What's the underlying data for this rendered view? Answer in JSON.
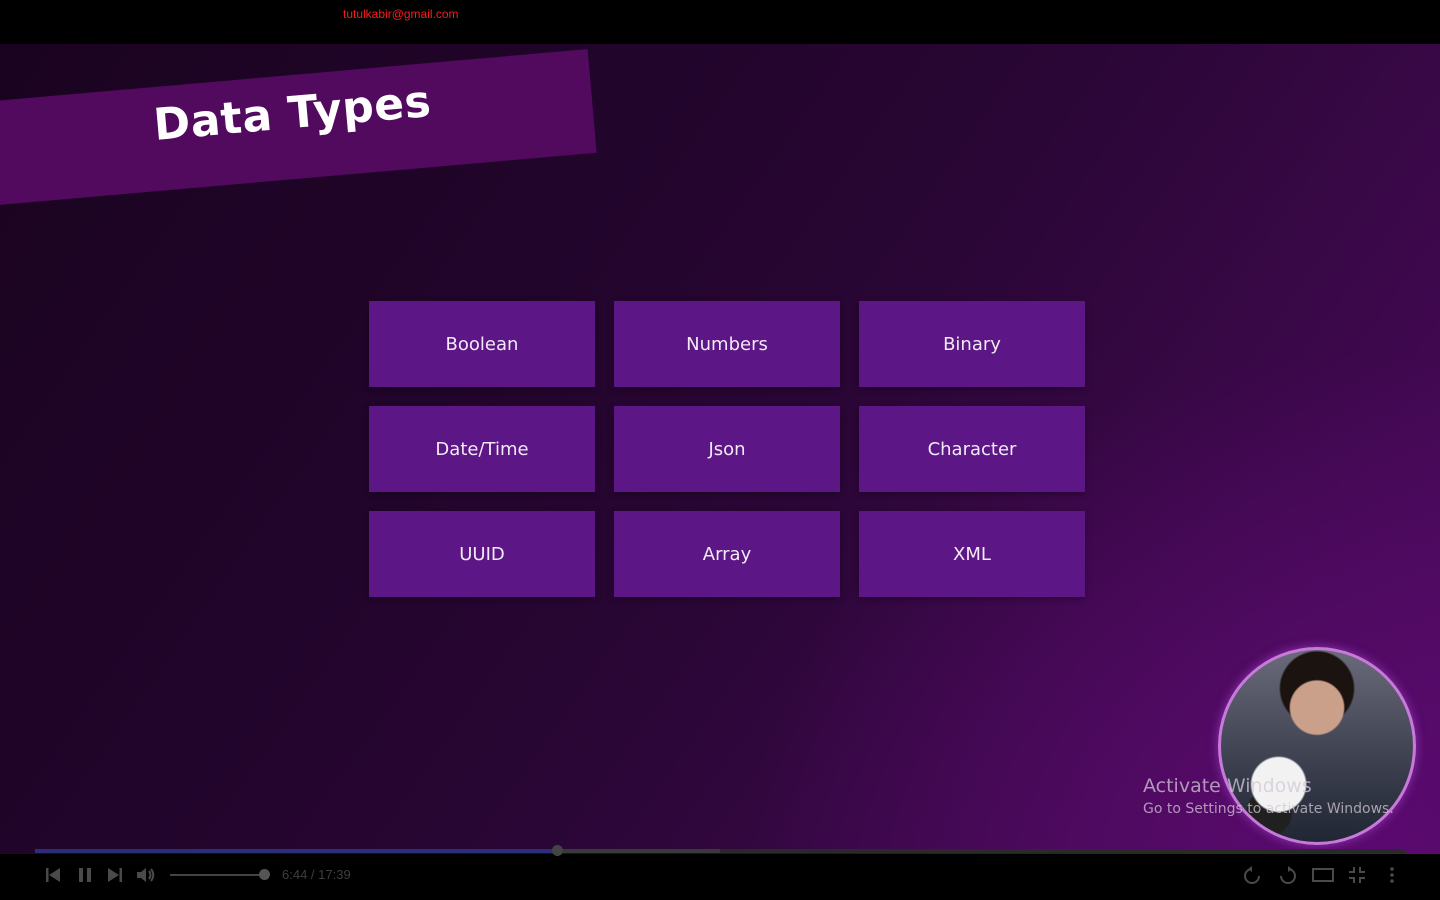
{
  "header": {
    "email": "tutulkabir@gmail.com"
  },
  "slide": {
    "title": "Data Types",
    "types": [
      "Boolean",
      "Numbers",
      "Binary",
      "Date/Time",
      "Json",
      "Character",
      "UUID",
      "Array",
      "XML"
    ]
  },
  "watermark": {
    "line1": "Activate Windows",
    "line2": "Go to Settings to activate Windows."
  },
  "player": {
    "current_time": "6:44",
    "separator": " / ",
    "duration": "17:39",
    "progress_fraction": 0.381,
    "buffered_fraction": 0.5,
    "volume_fraction": 1.0
  },
  "icons": {
    "prev": "skip-back-icon",
    "pause": "pause-icon",
    "next": "skip-forward-icon",
    "volume": "volume-icon",
    "replay": "rewind-10-icon",
    "forward": "forward-10-icon",
    "theater": "theater-mode-icon",
    "exit_fullscreen": "exit-fullscreen-icon",
    "more": "more-vert-icon"
  },
  "colors": {
    "tile": "#5c1685",
    "banner": "#520a5e",
    "email": "#ff1a1a"
  }
}
